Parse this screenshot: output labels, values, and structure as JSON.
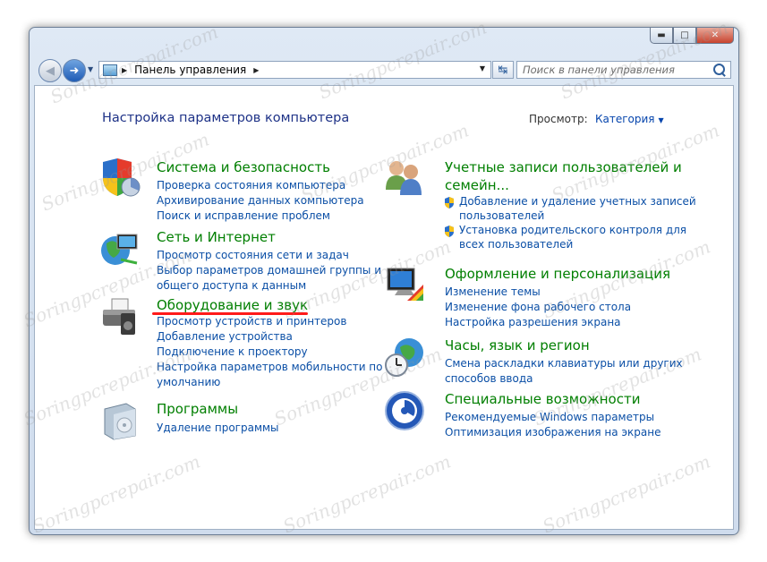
{
  "window": {
    "buttons": {
      "minimize": "▬",
      "maximize": "□",
      "close": "✕"
    }
  },
  "nav": {
    "address_label": "Панель управления",
    "search_placeholder": "Поиск в панели управления"
  },
  "main": {
    "heading": "Настройка параметров компьютера",
    "view_label": "Просмотр:",
    "view_value": "Категория"
  },
  "categories": {
    "security": {
      "title": "Система и безопасность",
      "links": [
        "Проверка состояния компьютера",
        "Архивирование данных компьютера",
        "Поиск и исправление проблем"
      ],
      "icon": "shield-icon"
    },
    "network": {
      "title": "Сеть и Интернет",
      "links": [
        "Просмотр состояния сети и задач",
        "Выбор параметров домашней группы и",
        "общего доступа к данным"
      ],
      "icon": "network-globe-icon"
    },
    "hardware": {
      "title": "Оборудование и звук",
      "links": [
        "Просмотр устройств и принтеров",
        "Добавление устройства",
        "Подключение к проектору",
        "Настройка параметров мобильности по",
        "умолчанию"
      ],
      "icon": "printer-icon"
    },
    "programs": {
      "title": "Программы",
      "links": [
        "Удаление программы"
      ],
      "icon": "programs-box-icon"
    },
    "users": {
      "title_line1": "Учетные записи пользователей и",
      "title_line2": "семейн...",
      "links": [
        "Добавление и удаление учетных записей",
        "пользователей",
        "Установка родительского контроля для",
        "всех пользователей"
      ],
      "icon": "users-icon"
    },
    "appearance": {
      "title": "Оформление и персонализация",
      "links": [
        "Изменение темы",
        "Изменение фона рабочего стола",
        "Настройка разрешения экрана"
      ],
      "icon": "monitor-palette-icon"
    },
    "clock": {
      "title": "Часы, язык и регион",
      "links": [
        "Смена раскладки клавиатуры или других",
        "способов ввода"
      ],
      "icon": "clock-globe-icon"
    },
    "access": {
      "title": "Специальные возможности",
      "links": [
        "Рекомендуемые Windows параметры",
        "Оптимизация изображения на экране"
      ],
      "icon": "accessibility-icon"
    }
  },
  "watermark": "Soringpcrepair.com",
  "colors": {
    "link": "#0b4fa6",
    "category_title": "#007f00",
    "heading": "#1e3287",
    "highlight": "#ff1a1a"
  }
}
